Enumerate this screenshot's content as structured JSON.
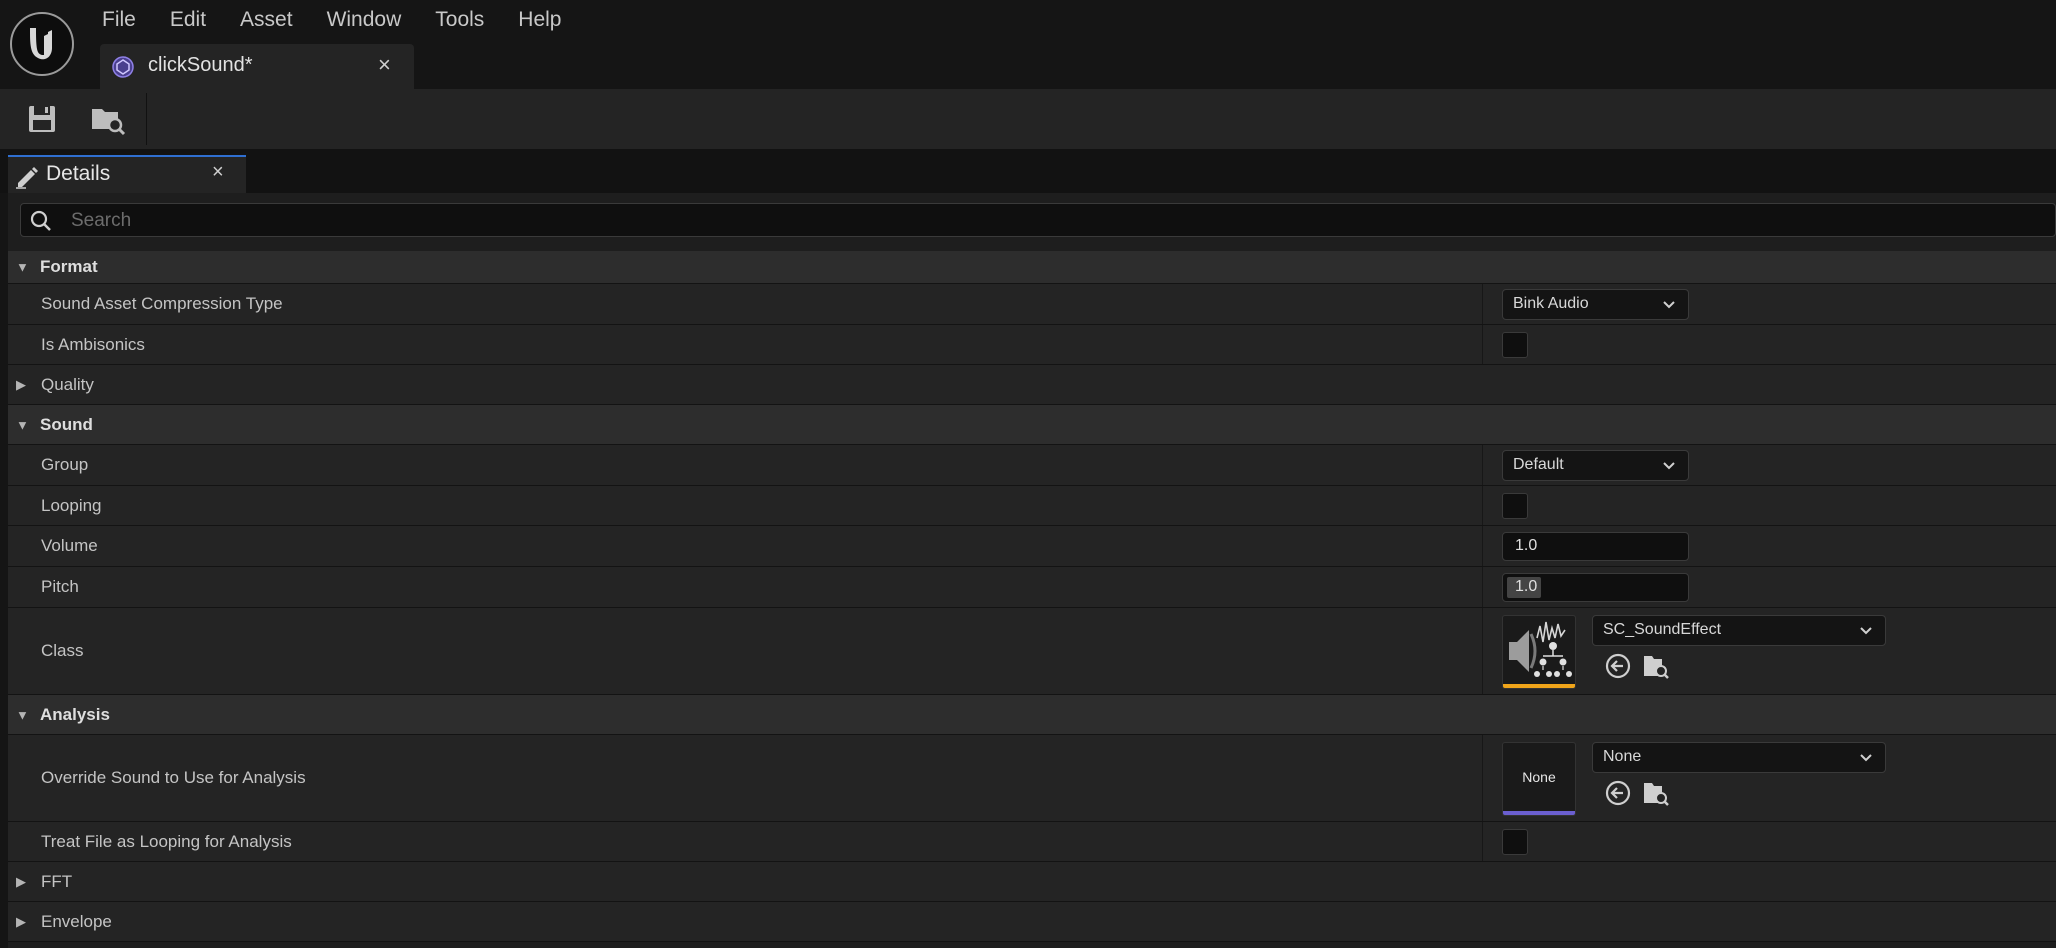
{
  "menubar": {
    "items": [
      "File",
      "Edit",
      "Asset",
      "Window",
      "Tools",
      "Help"
    ]
  },
  "document_tab": {
    "title": "clickSound*",
    "close_glyph": "×",
    "icon": "sound-wave-asset-icon"
  },
  "toolbar": {
    "buttons": [
      "save-icon",
      "browse-folder-icon"
    ]
  },
  "details_tab": {
    "title": "Details",
    "close_glyph": "×",
    "icon": "pencil-details-icon"
  },
  "search": {
    "placeholder": "Search",
    "value": ""
  },
  "sections": {
    "format": {
      "label": "Format",
      "compression_label": "Sound Asset Compression Type",
      "compression_value": "Bink Audio",
      "ambisonics_label": "Is Ambisonics",
      "ambisonics_checked": false
    },
    "quality": {
      "label": "Quality"
    },
    "sound": {
      "label": "Sound",
      "group_label": "Group",
      "group_value": "Default",
      "looping_label": "Looping",
      "looping_checked": false,
      "volume_label": "Volume",
      "volume_value": "1.0",
      "pitch_label": "Pitch",
      "pitch_value": "1.0",
      "class_label": "Class",
      "class_value": "SC_SoundEffect",
      "class_thumb_color": "#f0a51a"
    },
    "analysis": {
      "label": "Analysis",
      "override_label": "Override Sound to Use for Analysis",
      "override_value": "None",
      "override_thumb_text": "None",
      "override_thumb_color": "#6b5fd0",
      "treat_label": "Treat File as Looping for Analysis",
      "treat_checked": false
    },
    "fft": {
      "label": "FFT"
    },
    "envelope": {
      "label": "Envelope"
    }
  },
  "colors": {
    "accent_tab": "#2f6fd1",
    "background": "#151515",
    "panel": "#242424",
    "category": "#2d2d2d"
  }
}
